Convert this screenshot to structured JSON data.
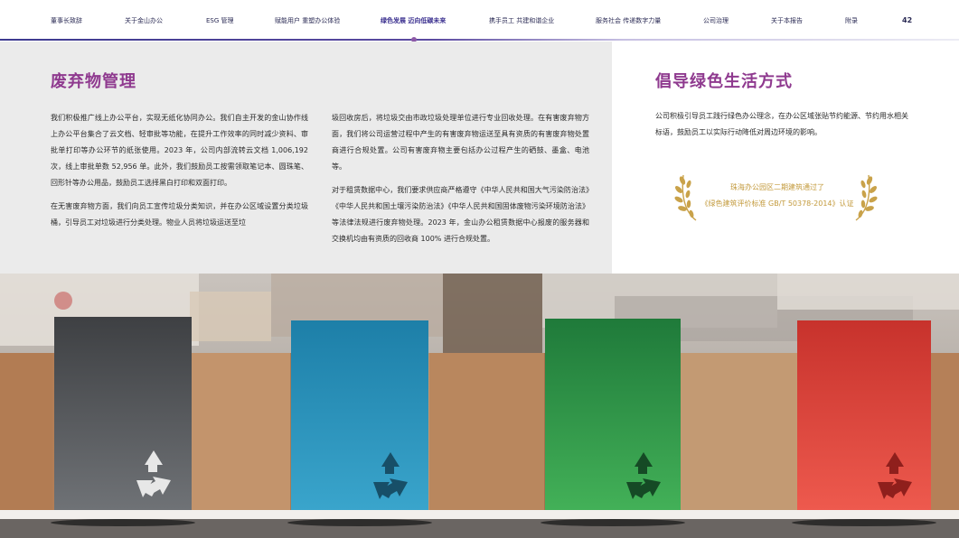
{
  "nav": {
    "items": [
      {
        "label": "董事长致辞",
        "active": false
      },
      {
        "label": "关于金山办公",
        "active": false
      },
      {
        "label": "ESG 管理",
        "active": false
      },
      {
        "label": "赋能用户 重塑办公体验",
        "active": false
      },
      {
        "label": "绿色发展 迈向低碳未来",
        "active": true
      },
      {
        "label": "携手员工 共建和谐企业",
        "active": false
      },
      {
        "label": "服务社会 传递数字力量",
        "active": false
      },
      {
        "label": "公司治理",
        "active": false
      },
      {
        "label": "关于本报告",
        "active": false
      },
      {
        "label": "附录",
        "active": false
      }
    ],
    "page_number": "42"
  },
  "waste": {
    "title": "废弃物管理",
    "col1": [
      "我们积极推广线上办公平台，实现无纸化协同办公。我们自主开发的金山协作线上办公平台集合了云文档、轻审批等功能，在提升工作效率的同时减少资料、审批单打印等办公环节的纸张使用。2023 年，公司内部流转云文档 1,006,192 次，线上审批单数 52,956 单。此外，我们鼓励员工按需领取笔记本、圆珠笔、回形针等办公用品，鼓励员工选择黑白打印和双面打印。",
      "在无害废弃物方面，我们向员工宣传垃圾分类知识，并在办公区域设置分类垃圾桶，引导员工对垃圾进行分类处理。物业人员将垃圾运送至垃"
    ],
    "col2": [
      "圾回收房后，将垃圾交由市政垃圾处理单位进行专业回收处理。在有害废弃物方面，我们将公司运营过程中产生的有害废弃物运送至具有资质的有害废弃物处置商进行合规处置。公司有害废弃物主要包括办公过程产生的硒鼓、墨盒、电池等。",
      "对于租赁数据中心，我们要求供应商严格遵守《中华人民共和国大气污染防治法》《中华人民共和国土壤污染防治法》《中华人民共和国固体废物污染环境防治法》等法律法规进行废弃物处理。2023 年，金山办公租赁数据中心报废的服务器和交换机均由有资质的回收商 100% 进行合规处置。"
    ]
  },
  "green": {
    "title": "倡导绿色生活方式",
    "body": "公司积极引导员工践行绿色办公理念，在办公区域张贴节约能源、节约用水相关标语，鼓励员工以实际行动降低对周边环境的影响。",
    "award_line1": "珠海办公园区二期建筑通过了",
    "award_line2": "《绿色建筑评价标准 GB/T 50378-2014》认证"
  },
  "photo": {
    "bins": [
      {
        "name": "gray",
        "color": "#55585d"
      },
      {
        "name": "blue",
        "color": "#2b8fb4"
      },
      {
        "name": "green",
        "color": "#3a9a4c"
      },
      {
        "name": "red",
        "color": "#d93f36"
      }
    ],
    "symbols": [
      "recycle-icon",
      "laurel-icon"
    ]
  }
}
